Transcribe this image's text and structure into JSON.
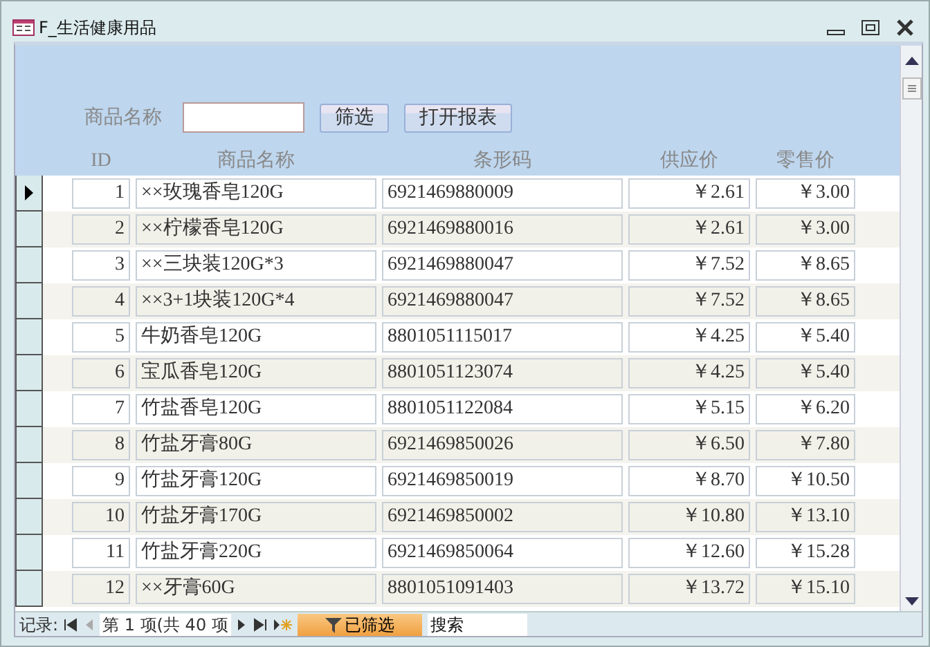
{
  "window": {
    "title": "F_生活健康用品"
  },
  "filter": {
    "label": "商品名称",
    "buttons": [
      "筛选",
      "打开报表"
    ]
  },
  "table": {
    "columns": [
      "ID",
      "商品名称",
      "条形码",
      "供应价",
      "零售价"
    ],
    "rows": [
      {
        "selected": true,
        "cells": [
          "1",
          "××玫瑰香皂120G",
          "6921469880009",
          "￥2.61",
          "￥3.00"
        ]
      },
      {
        "selected": false,
        "cells": [
          "2",
          "××柠檬香皂120G",
          "6921469880016",
          "￥2.61",
          "￥3.00"
        ]
      },
      {
        "selected": false,
        "cells": [
          "3",
          "××三块装120G*3",
          "6921469880047",
          "￥7.52",
          "￥8.65"
        ]
      },
      {
        "selected": false,
        "cells": [
          "4",
          "××3+1块装120G*4",
          "6921469880047",
          "￥7.52",
          "￥8.65"
        ]
      },
      {
        "selected": false,
        "cells": [
          "5",
          "牛奶香皂120G",
          "8801051115017",
          "￥4.25",
          "￥5.40"
        ]
      },
      {
        "selected": false,
        "cells": [
          "6",
          "宝瓜香皂120G",
          "8801051123074",
          "￥4.25",
          "￥5.40"
        ]
      },
      {
        "selected": false,
        "cells": [
          "7",
          "竹盐香皂120G",
          "8801051122084",
          "￥5.15",
          "￥6.20"
        ]
      },
      {
        "selected": false,
        "cells": [
          "8",
          "竹盐牙膏80G",
          "6921469850026",
          "￥6.50",
          "￥7.80"
        ]
      },
      {
        "selected": false,
        "cells": [
          "9",
          "竹盐牙膏120G",
          "6921469850019",
          "￥8.70",
          "￥10.50"
        ]
      },
      {
        "selected": false,
        "cells": [
          "10",
          "竹盐牙膏170G",
          "6921469850002",
          "￥10.80",
          "￥13.10"
        ]
      },
      {
        "selected": false,
        "cells": [
          "11",
          "竹盐牙膏220G",
          "6921469850064",
          "￥12.60",
          "￥15.28"
        ]
      },
      {
        "selected": false,
        "cells": [
          "12",
          "××牙膏60G",
          "8801051091403",
          "￥13.72",
          "￥15.10"
        ]
      }
    ]
  },
  "status_bar": {
    "label": "记录:",
    "position": "第 1 项(共 40 项",
    "filter": "已筛选",
    "search_placeholder": "搜索"
  }
}
